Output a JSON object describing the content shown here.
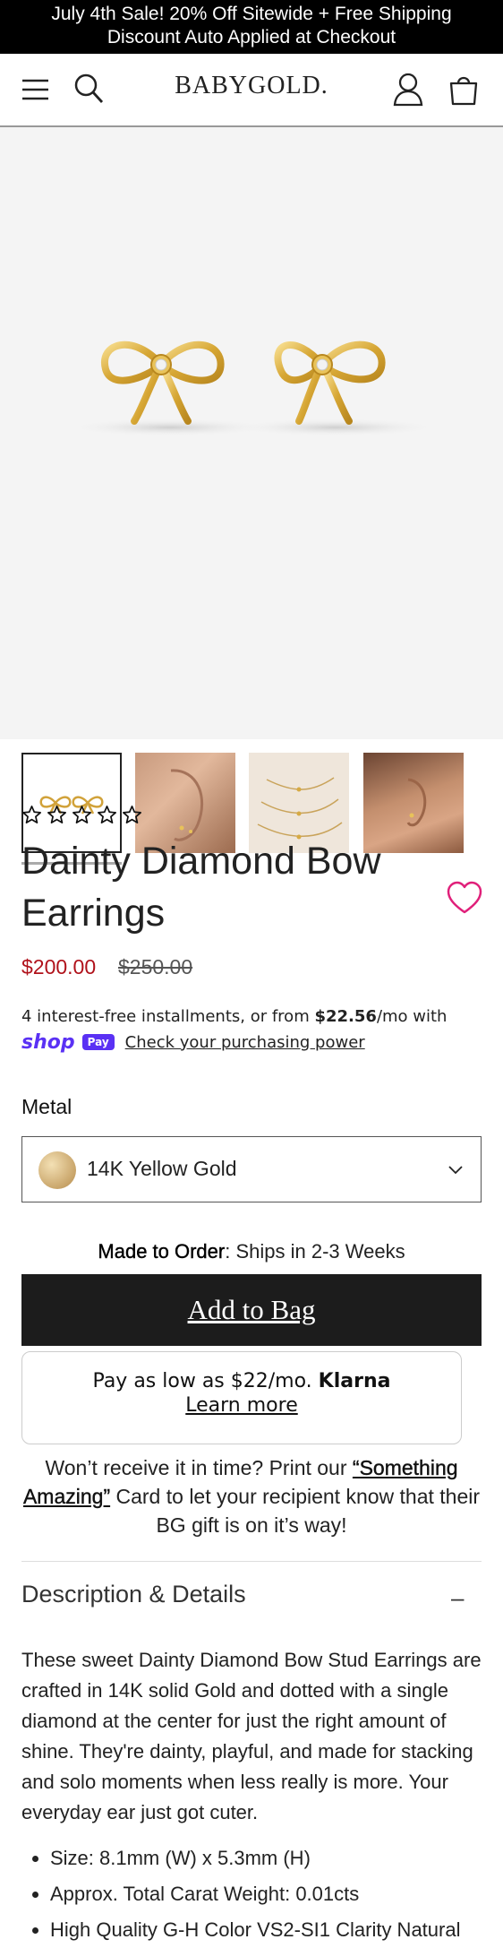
{
  "announcement": {
    "line1": "July 4th Sale! 20% Off Sitewide + Free Shipping",
    "line2": "Discount Auto Applied at Checkout"
  },
  "header": {
    "logo": "BABYGOLD.",
    "icons": [
      "menu-icon",
      "search-icon",
      "account-icon",
      "bag-icon"
    ]
  },
  "gallery": {
    "thumbnails": [
      "bow-earrings-product",
      "ear-closeup-gold-studs",
      "necklaces-flatlay",
      "ear-closeup-side"
    ],
    "active_index": 0
  },
  "product": {
    "rating_stars": 0,
    "title": "Dainty Diamond Bow Earrings",
    "price": "$200.00",
    "compare_price": "$250.00",
    "installments": {
      "prefix": "4 interest-free installments, or from ",
      "amount": "$22.56",
      "suffix": "/mo with",
      "shop_word": "shop",
      "pay_badge": "Pay",
      "link": "Check your purchasing power"
    },
    "metal_label": "Metal",
    "metal_value": "14K Yellow Gold",
    "ship_label": "Made to Order",
    "ship_text": ": Ships in 2-3 Weeks",
    "add_to_bag": "Add to Bag",
    "klarna": {
      "text": "Pay as low as $22/mo. ",
      "brand": "Klarna",
      "link": "Learn more"
    },
    "promo": {
      "before": "Won’t receive it in time? Print our ",
      "link": "“Something Amazing”",
      "after": " Card to let your recipient know that their BG gift is on it’s way!"
    }
  },
  "description": {
    "heading": "Description & Details",
    "toggle": "–",
    "body": "These sweet Dainty Diamond Bow Stud Earrings are crafted in 14K solid Gold and dotted with a single diamond at the center for just the right amount of shine. They're dainty, playful, and made for stacking and solo moments when less really is more. Your everyday ear just got cuter.",
    "bullets": [
      "Size: 8.1mm (W) x 5.3mm (H)",
      "Approx. Total Carat Weight: 0.01cts",
      "High Quality G-H Color VS2-SI1 Clarity Natural"
    ]
  },
  "colors": {
    "announcement_bg": "#000000",
    "price_sale": "#b0121b",
    "heart": "#e0207a",
    "add_to_bag_bg": "#1c1c1c",
    "shop_pay": "#5a31f4"
  }
}
